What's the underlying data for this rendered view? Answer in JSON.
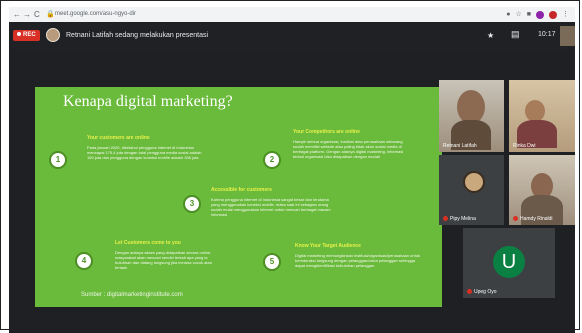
{
  "browser": {
    "back": "←",
    "forward": "→",
    "reload": "C",
    "url": "meet.google.com/asu-ngyo-dir"
  },
  "meet": {
    "rec_label": "REC",
    "presenting_text": "Retnani Latifah sedang melakukan presentasi",
    "time": "10:17"
  },
  "slide": {
    "title": "Kenapa digital marketing?",
    "sections": [
      {
        "num": "1",
        "heading": "Your customers are online",
        "text": "Pada januari 2020, diketahui pengguna internet di Indonesia mencapai 175,4 juta dengan total pengguna media sosial adalah 160 juta dan pengguna dengan koneksi mobile adalah 338 juta"
      },
      {
        "num": "2",
        "heading": "Your Competitors are online",
        "text": "Hampir semua organisasi, institusi atau perusahaan sekarang sudah memiliki website atau paling tidak akun sosial media di berbagai platform. Dengan adanya digital marketing, informasi terkait organisasi bisa didapatkan dengan mudah"
      },
      {
        "num": "3",
        "heading": "Accessible for customers",
        "text": "Karena pengguna internet di Indonesia sangat besar dan terutama yang menggunakan koneksi mobile, maka saat ini sebagian orang sudah mulai menggunakan internet untuk mencari berbagai macam informasi"
      },
      {
        "num": "4",
        "heading": "Let Customers come to you",
        "text": "Dengan adanya akses yang didapatkan secara online, masyarakat akan mencari sendiri terkait apa yang ia butuhkan dan datang langsung jika merasa cocok atau tertarik"
      },
      {
        "num": "5",
        "heading": "Know Your Target Audience",
        "text": "Digital marketing memungkinkan institusi/organisasi/perusahaan untuk berinteraksi langsung dengan pelanggan/calon pelanggan sehingga dapat mengidentifikasi kebutuhan pelanggan"
      }
    ],
    "source": "Sumber : digitalmarketinginstitute.com"
  },
  "participants": [
    {
      "name": "Retnani Latifah"
    },
    {
      "name": "Rinka Dwi"
    },
    {
      "name": "Pipy Melina"
    },
    {
      "name": "Hamdy Rinaldi"
    },
    {
      "name": "Upeg Oyo",
      "initial": "U"
    }
  ],
  "colors": {
    "slide_green": "#6aba3b",
    "heading_yellow": "#e9f24a",
    "rec_red": "#d93025",
    "avatar_green": "#0b8043",
    "meet_bg": "#1f2023"
  }
}
